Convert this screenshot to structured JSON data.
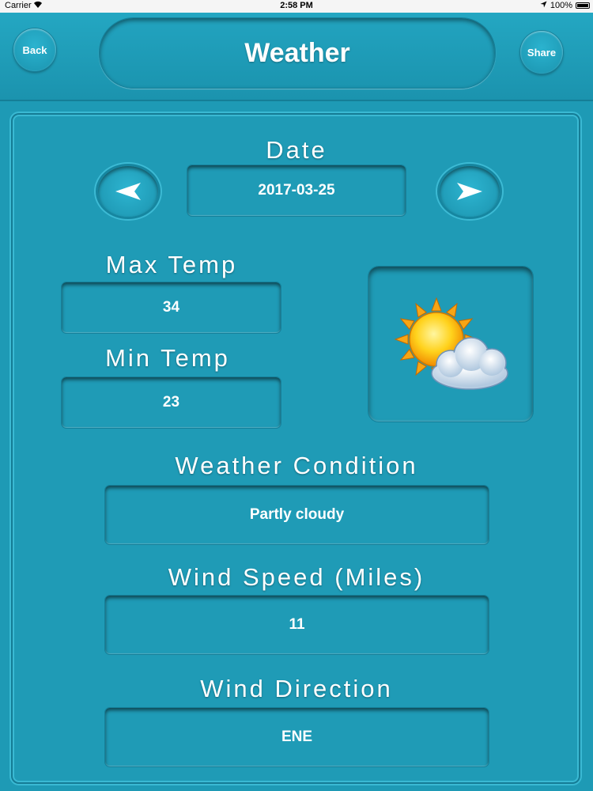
{
  "status_bar": {
    "carrier": "Carrier",
    "time": "2:58 PM",
    "battery": "100%"
  },
  "header": {
    "back_label": "Back",
    "title": "Weather",
    "share_label": "Share"
  },
  "date": {
    "label": "Date",
    "value": "2017-03-25"
  },
  "max_temp": {
    "label": "Max Temp",
    "value": "34"
  },
  "min_temp": {
    "label": "Min Temp",
    "value": "23"
  },
  "weather_icon": "partly-cloudy-icon",
  "condition": {
    "label": "Weather Condition",
    "value": "Partly cloudy"
  },
  "wind_speed": {
    "label": "Wind Speed (Miles)",
    "value": "11"
  },
  "wind_direction": {
    "label": "Wind Direction",
    "value": "ENE"
  },
  "colors": {
    "background": "#1e9ab5",
    "text": "#ffffff"
  }
}
